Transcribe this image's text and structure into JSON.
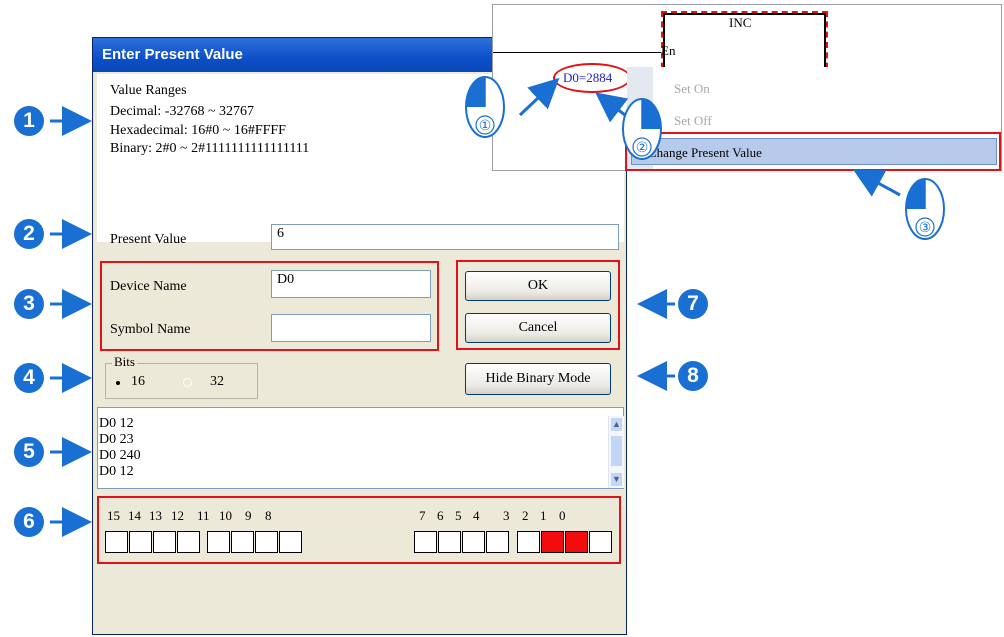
{
  "dialog": {
    "title": "Enter Present Value",
    "value_ranges": {
      "heading": "Value Ranges",
      "decimal": "Decimal: -32768 ~ 32767",
      "hexadecimal": "Hexadecimal: 16#0 ~ 16#FFFF",
      "binary": "Binary: 2#0 ~ 2#1111111111111111"
    },
    "present_value_label": "Present Value",
    "present_value": "6",
    "device_name_label": "Device Name",
    "device_name": "D0",
    "symbol_name_label": "Symbol Name",
    "symbol_name": "",
    "ok_label": "OK",
    "cancel_label": "Cancel",
    "bits": {
      "label": "Bits",
      "options": [
        "16",
        "32"
      ],
      "selected": "16"
    },
    "hide_binary_label": "Hide Binary Mode",
    "history": [
      "D0 12",
      "D0 23",
      "D0 240",
      "D0 12"
    ],
    "bit_labels_high": [
      "15",
      "14",
      "13",
      "12",
      "11",
      "10",
      "9",
      "8"
    ],
    "bit_labels_low": [
      "7",
      "6",
      "5",
      "4",
      "3",
      "2",
      "1",
      "0"
    ],
    "bits_set": [
      1,
      2
    ]
  },
  "ladder": {
    "instruction": "INC",
    "pin": "En",
    "device_value": "D0=2884"
  },
  "context_menu": {
    "items": [
      "Set On",
      "Set Off",
      "Change Present Value"
    ],
    "highlighted": "Change Present Value"
  },
  "callouts": [
    "1",
    "2",
    "3",
    "4",
    "5",
    "6",
    "7",
    "8"
  ],
  "mouse_steps": [
    "①",
    "②",
    "③"
  ],
  "colors": {
    "callout": "#1a6fd3",
    "highlight": "#e1131a",
    "bit_on": "#f20c0c"
  }
}
